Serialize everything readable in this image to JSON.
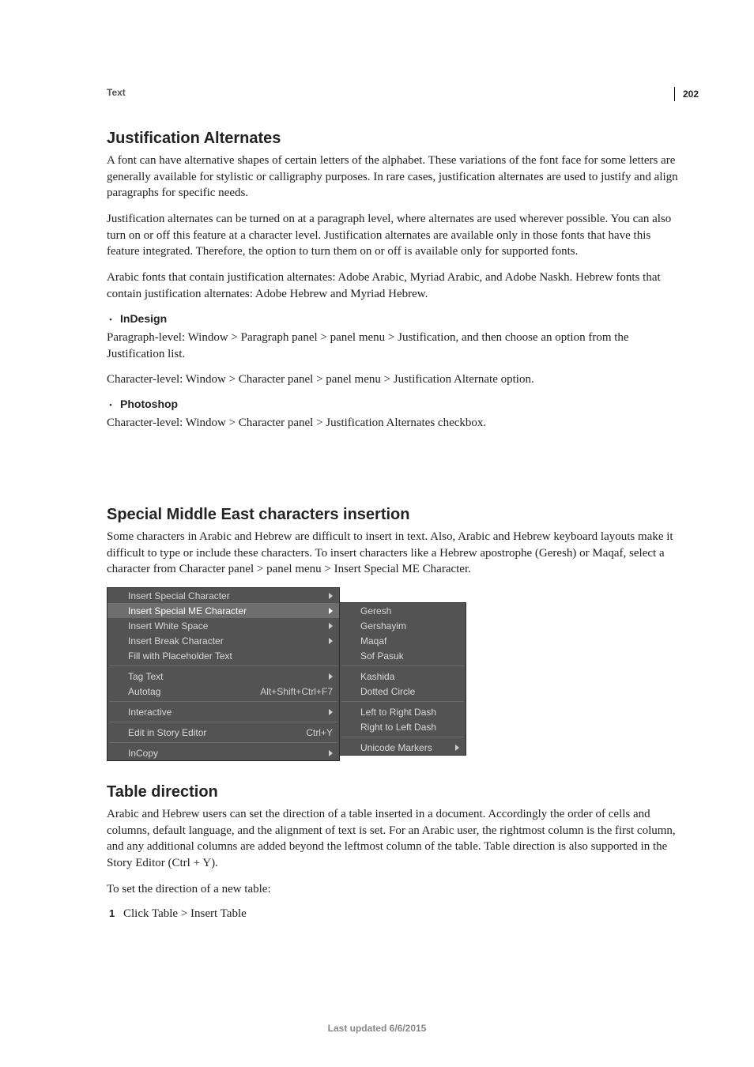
{
  "page_number": "202",
  "chapter_label": "Text",
  "sections": {
    "justification": {
      "heading": "Justification Alternates",
      "p1": "A font can have alternative shapes of certain letters of the alphabet. These variations of the font face for some letters are generally available for stylistic or calligraphy purposes. In rare cases, justification alternates are used to justify and align paragraphs for specific needs.",
      "p2": "Justification alternates can be turned on at a paragraph level, where alternates are used wherever possible. You can also turn on or off this feature at a character level. Justification alternates are available only in those fonts that have this feature integrated. Therefore, the option to turn them on or off is available only for supported fonts.",
      "p3": "Arabic fonts that contain justification alternates: Adobe Arabic, Myriad Arabic, and Adobe Naskh. Hebrew fonts that contain justification alternates: Adobe Hebrew and Myriad Hebrew.",
      "bullet_indesign": "InDesign",
      "p4": "Paragraph-level: Window > Paragraph panel > panel menu > Justification, and then choose an option from the Justification list.",
      "p5": "Character-level: Window > Character panel > panel menu > Justification Alternate option.",
      "bullet_photoshop": "Photoshop",
      "p6": "Character-level: Window > Character panel > Justification Alternates checkbox."
    },
    "specialme": {
      "heading": "Special Middle East characters insertion",
      "p1": "Some characters in Arabic and Hebrew are difficult to insert in text. Also, Arabic and Hebrew keyboard layouts make it difficult to type or include these characters. To insert characters like a Hebrew apostrophe (Geresh) or Maqaf, select a character from Character panel > panel menu > Insert Special ME Character."
    },
    "tabledir": {
      "heading": "Table direction",
      "p1": "Arabic and Hebrew users can set the direction of a table inserted in a document. Accordingly the order of cells and columns, default language, and the alignment of text is set. For an Arabic user, the rightmost column is the first column, and any additional columns are added beyond the leftmost column of the table. Table direction is also supported in the Story Editor (Ctrl + Y).",
      "p2": "To set the direction of a new table:",
      "step1_num": "1",
      "step1_text": "Click Table > Insert Table"
    }
  },
  "menu": {
    "left": [
      {
        "label": "Insert Special Character",
        "shortcut": "",
        "arrow": true,
        "highlight": false
      },
      {
        "label": "Insert Special ME Character",
        "shortcut": "",
        "arrow": true,
        "highlight": true
      },
      {
        "label": "Insert White Space",
        "shortcut": "",
        "arrow": true,
        "highlight": false
      },
      {
        "label": "Insert Break Character",
        "shortcut": "",
        "arrow": true,
        "highlight": false
      },
      {
        "label": "Fill with Placeholder Text",
        "shortcut": "",
        "arrow": false,
        "highlight": false
      }
    ],
    "left2": [
      {
        "label": "Tag Text",
        "shortcut": "",
        "arrow": true,
        "highlight": false
      },
      {
        "label": "Autotag",
        "shortcut": "Alt+Shift+Ctrl+F7",
        "arrow": false,
        "highlight": false
      }
    ],
    "left3": [
      {
        "label": "Interactive",
        "shortcut": "",
        "arrow": true,
        "highlight": false
      }
    ],
    "left4": [
      {
        "label": "Edit in Story Editor",
        "shortcut": "Ctrl+Y",
        "arrow": false,
        "highlight": false
      }
    ],
    "left5": [
      {
        "label": "InCopy",
        "shortcut": "",
        "arrow": true,
        "highlight": false
      }
    ],
    "right": [
      {
        "label": "Geresh",
        "arrow": false
      },
      {
        "label": "Gershayim",
        "arrow": false
      },
      {
        "label": "Maqaf",
        "arrow": false
      },
      {
        "label": "Sof Pasuk",
        "arrow": false
      }
    ],
    "right2": [
      {
        "label": "Kashida",
        "arrow": false
      },
      {
        "label": "Dotted Circle",
        "arrow": false
      }
    ],
    "right3": [
      {
        "label": "Left to Right Dash",
        "arrow": false
      },
      {
        "label": "Right to Left Dash",
        "arrow": false
      }
    ],
    "right4": [
      {
        "label": "Unicode Markers",
        "arrow": true
      }
    ]
  },
  "footer": "Last updated 6/6/2015"
}
